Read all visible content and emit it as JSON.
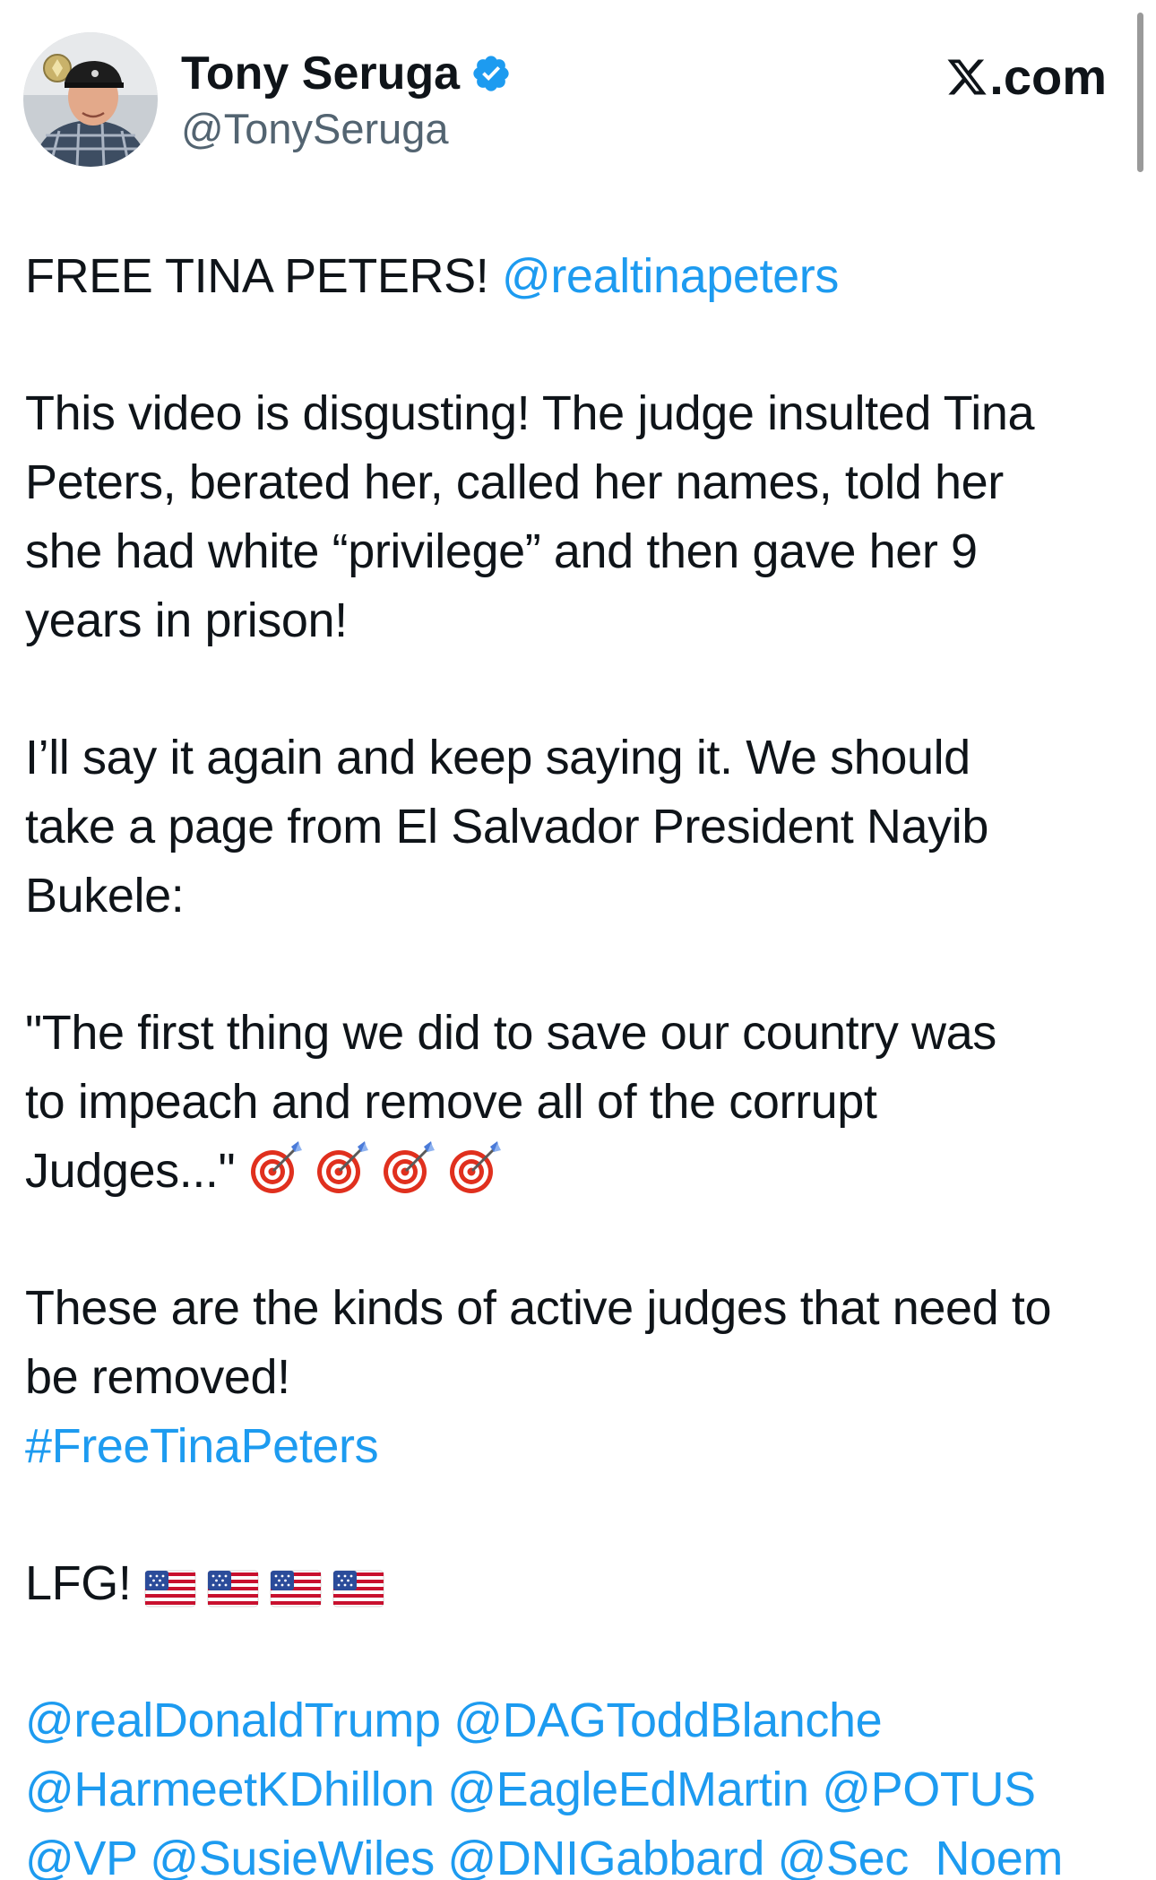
{
  "author": {
    "name": "Tony Seruga",
    "handle": "@TonySeruga",
    "verified": true
  },
  "brand": {
    "label": ".com",
    "icon": "x-logo-icon"
  },
  "colors": {
    "link": "#1d9bf0",
    "verified": "#1d9bf0",
    "text": "#0f1419",
    "handle": "#536471"
  },
  "post": {
    "p1": {
      "text": "FREE TINA PETERS!",
      "mention": "@realtinapeters"
    },
    "p2": [
      "This video is disgusting! The judge insulted Tina",
      "Peters, berated her, called her names, told her",
      "she had white “privilege” and then gave her 9",
      "years in prison!"
    ],
    "p3": [
      "I’ll say it again and keep saying it. We should",
      "take a page from El Salvador President Nayib",
      "Bukele:"
    ],
    "p4": [
      "\"The first thing we did to save our country was",
      "to impeach and remove all of the corrupt",
      "Judges...\""
    ],
    "p4_emoji": [
      "direct-hit-icon",
      "direct-hit-icon",
      "direct-hit-icon",
      "direct-hit-icon"
    ],
    "p5": [
      "These are the kinds of active judges that need to",
      "be removed!"
    ],
    "hashtag": "#FreeTinaPeters",
    "p6": {
      "text": "LFG!",
      "emoji": [
        "us-flag-icon",
        "us-flag-icon",
        "us-flag-icon",
        "us-flag-icon"
      ]
    },
    "mentions": [
      [
        "@realDonaldTrump",
        "@DAGToddBlanche"
      ],
      [
        "@HarmeetKDhillon",
        "@EagleEdMartin",
        "@POTUS"
      ],
      [
        "@VP",
        "@SusieWiles",
        "@DNIGabbard",
        "@Sec_Noem"
      ]
    ]
  }
}
